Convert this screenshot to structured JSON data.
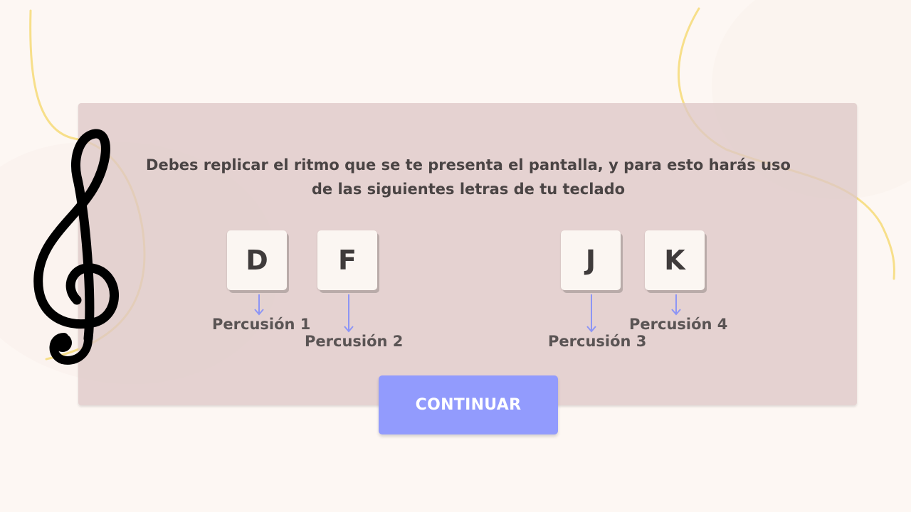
{
  "instruction": "Debes replicar el ritmo que se te presenta el pantalla, y para esto harás uso de las siguientes letras de tu teclado",
  "keys": [
    {
      "letter": "D",
      "label": "Percusión 1"
    },
    {
      "letter": "F",
      "label": "Percusión 2"
    },
    {
      "letter": "J",
      "label": "Percusión 3"
    },
    {
      "letter": "K",
      "label": "Percusión 4"
    }
  ],
  "continue_label": "CONTINUAR",
  "icons": {
    "clef": "treble-clef-icon",
    "arrow": "arrow-down-icon"
  },
  "colors": {
    "background": "#fdf7f3",
    "panel": "#e2d0cf",
    "accent": "#929bfd",
    "key": "#fbf6f2",
    "text": "#4a4444",
    "decor_line": "#f7df8a"
  }
}
